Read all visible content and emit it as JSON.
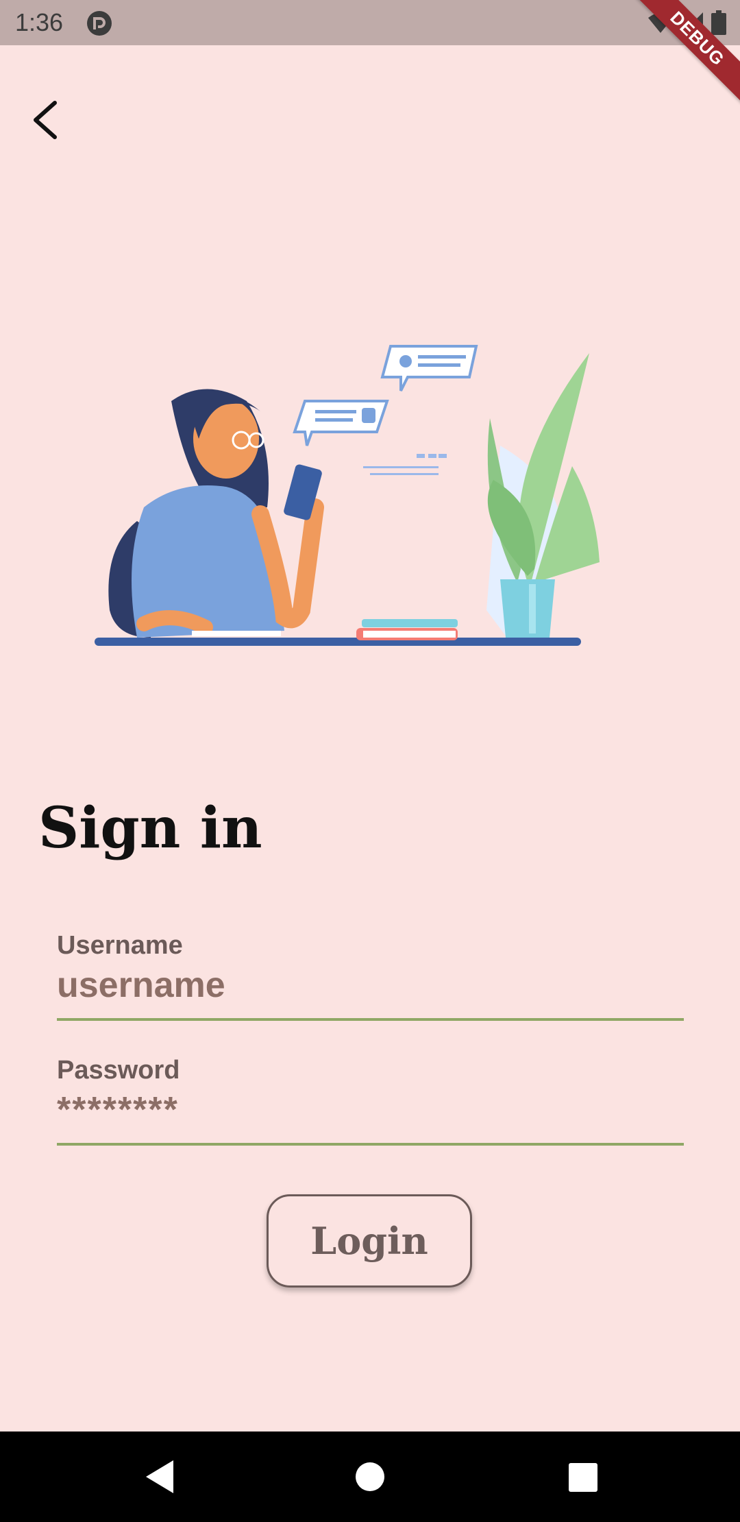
{
  "status_bar": {
    "time": "1:36",
    "icons": [
      "app-notification-icon",
      "wifi-icon",
      "signal-icon",
      "battery-icon"
    ],
    "debug_banner": "DEBUG"
  },
  "header": {
    "back_icon": "back-arrow-icon"
  },
  "illustration": {
    "description_icon": "woman-reading-phone-illustration"
  },
  "page": {
    "title": "Sign in"
  },
  "form": {
    "username_label": "Username",
    "username_placeholder": "username",
    "password_label": "Password",
    "password_placeholder": "********",
    "login_label": "Login"
  },
  "nav_bar": {
    "icons": [
      "nav-back-icon",
      "nav-home-icon",
      "nav-recents-icon"
    ]
  },
  "colors": {
    "background": "#fbe3e1",
    "status_bar": "#bfaba9",
    "underline": "#8fa765",
    "label": "#6b5a58",
    "input_text": "#8c6e66",
    "debug": "#a0292f"
  }
}
